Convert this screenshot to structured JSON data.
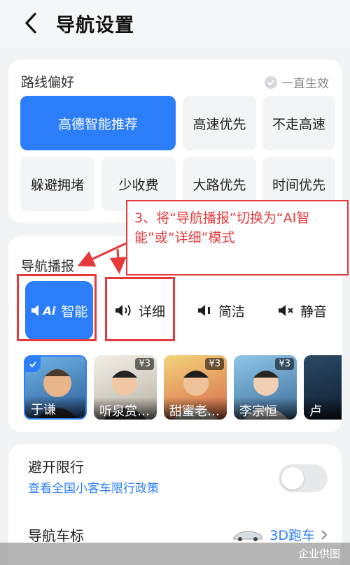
{
  "header": {
    "title": "导航设置"
  },
  "route": {
    "title": "路线偏好",
    "always_effective": "一直生效",
    "options": [
      "高德智能推荐",
      "高速优先",
      "不走高速",
      "躲避拥堵",
      "少收费",
      "大路优先",
      "时间优先"
    ],
    "selected": "高德智能推荐"
  },
  "broadcast": {
    "title": "导航播报",
    "modes": [
      {
        "label": "智能",
        "ai_badge": "Ai",
        "icon": "speaker-ai-icon"
      },
      {
        "label": "详细",
        "icon": "speaker-loud-icon"
      },
      {
        "label": "简洁",
        "icon": "speaker-low-icon"
      },
      {
        "label": "静音",
        "icon": "speaker-mute-icon"
      }
    ],
    "selected": "智能",
    "voices": [
      {
        "name": "于谦",
        "price": ""
      },
      {
        "name": "听泉赏…",
        "price": "¥3"
      },
      {
        "name": "甜蜜老…",
        "price": "¥3"
      },
      {
        "name": "李宗恒",
        "price": "¥3"
      },
      {
        "name": "卢",
        "price": ""
      }
    ]
  },
  "annotation": {
    "text": "3、将“导航播报”切换为“AI智能”或“详细”模式"
  },
  "settings": {
    "avoid_restriction": {
      "title": "避开限行",
      "link": "查看全国小客车限行政策",
      "enabled": false
    },
    "car_icon": {
      "title": "导航车标",
      "value": "3D跑车"
    }
  },
  "watermark": "企业供图",
  "colors": {
    "accent": "#2c7ef8",
    "annotation": "#e5393b"
  }
}
